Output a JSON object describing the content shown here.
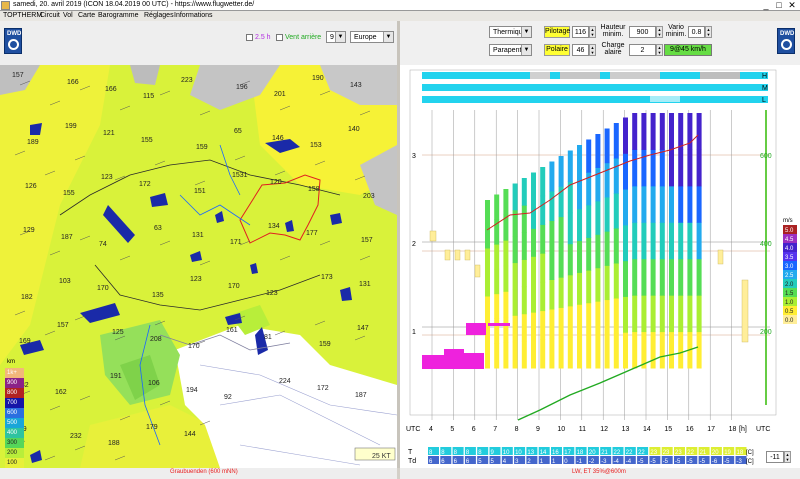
{
  "window": {
    "title": "samedi, 20. avril 2019 (ICON 18.04.2019 00 UTC) - https://www.flugwetter.de/",
    "minimize": "_",
    "maximize": "□",
    "close": "✕"
  },
  "menu": [
    "TOPTHERM",
    "Circuit",
    "Vol",
    "Carte",
    "Barogramme",
    "Réglages",
    "Informations"
  ],
  "map_toolbar": {
    "logo_text": "DWD",
    "time_value": "2.5 h",
    "tailwind_label": "Vent arrière",
    "level_value": "9",
    "region_value": "Europe"
  },
  "sounding_toolbar": {
    "logo_text": "DWD",
    "mode_value": "Thermique",
    "glider_value": "Parapente",
    "pilotage_label": "Pilotage",
    "pilotage_value": "116",
    "hauteur_label": "Hauteur minim.",
    "hauteur_value": "900",
    "vario_label": "Vario minim.",
    "vario_value": "0.8",
    "polaire_label": "Polaire",
    "polaire_value": "46",
    "charge_label": "Charge alaire",
    "charge_value": "2",
    "speed_value": "9@45 km/h"
  },
  "map": {
    "legend_title": "km",
    "legend": [
      {
        "label": "1k+",
        "color": "#f2b77a"
      },
      {
        "label": "900",
        "color": "#8b2288"
      },
      {
        "label": "800",
        "color": "#b22222"
      },
      {
        "label": "700",
        "color": "#1515a8"
      },
      {
        "label": "600",
        "color": "#2a6fe0"
      },
      {
        "label": "500",
        "color": "#19a6d8"
      },
      {
        "label": "400",
        "color": "#2ec3a0"
      },
      {
        "label": "300",
        "color": "#55d65a"
      },
      {
        "label": "200",
        "color": "#b8ee3a"
      },
      {
        "label": "100",
        "color": "#e8f03a"
      }
    ],
    "scale_label": "25 KT",
    "status": "Graubuenden (600 mNN)",
    "contour_labels": [
      "157",
      "166",
      "166",
      "115",
      "223",
      "196",
      "201",
      "190",
      "143",
      "189",
      "199",
      "121",
      "155",
      "159",
      "65",
      "146",
      "153",
      "140",
      "126",
      "155",
      "123",
      "172",
      "151",
      "1531",
      "120",
      "158",
      "203",
      "129",
      "187",
      "74",
      "63",
      "131",
      "171",
      "134",
      "177",
      "157",
      "182",
      "103",
      "170",
      "135",
      "123",
      "170",
      "123",
      "173",
      "131",
      "169",
      "157",
      "125",
      "208",
      "170",
      "161",
      "81",
      "159",
      "147",
      "132",
      "162",
      "191",
      "106",
      "194",
      "92",
      "224",
      "172",
      "187",
      "109",
      "232",
      "188",
      "179",
      "144"
    ]
  },
  "sounding": {
    "rows_label": [
      "H",
      "M",
      "L"
    ],
    "axis_left": [
      "3",
      "2",
      "1"
    ],
    "axis_right_top": "600",
    "axis_right_mid": "400",
    "axis_right_low": "200",
    "hours_label": "UTC",
    "hours": [
      "4",
      "5",
      "6",
      "7",
      "8",
      "9",
      "10",
      "11",
      "12",
      "13",
      "14",
      "15",
      "16",
      "17",
      "18"
    ],
    "hours_unit": "[h]",
    "hours_label_right": "UTC",
    "vario_unit": "m/s",
    "vario_scale": [
      {
        "label": "5.0",
        "color": "#aa2222"
      },
      {
        "label": "4.5",
        "color": "#9b30c0"
      },
      {
        "label": "4.0",
        "color": "#4422cc"
      },
      {
        "label": "3.5",
        "color": "#5533ee"
      },
      {
        "label": "3.0",
        "color": "#1a66ff"
      },
      {
        "label": "2.5",
        "color": "#22aaee"
      },
      {
        "label": "2.0",
        "color": "#22ccbb"
      },
      {
        "label": "1.5",
        "color": "#55dd55"
      },
      {
        "label": "1.0",
        "color": "#aaee33"
      },
      {
        "label": "0.5",
        "color": "#ffee33"
      },
      {
        "label": "0.0",
        "color": "#ffee99"
      }
    ],
    "t_label": "T",
    "td_label": "Td",
    "t_unit": "[C]",
    "td_unit": "[C]",
    "offset_value": "-11",
    "t_row": [
      "8",
      "8",
      "8",
      "8",
      "8",
      "9",
      "10",
      "10",
      "13",
      "14",
      "16",
      "17",
      "18",
      "20",
      "21",
      "22",
      "22",
      "22",
      "23",
      "23",
      "23",
      "22",
      "21",
      "20",
      "19",
      "18"
    ],
    "td_row": [
      "6",
      "6",
      "6",
      "6",
      "5",
      "5",
      "4",
      "3",
      "2",
      "1",
      "1",
      "0",
      "-1",
      "-2",
      "-3",
      "-4",
      "-4",
      "-5",
      "-5",
      "-5",
      "-5",
      "-5",
      "-5",
      "-6",
      "-5",
      "-3"
    ],
    "status": "LW, ET 35%@600m"
  }
}
